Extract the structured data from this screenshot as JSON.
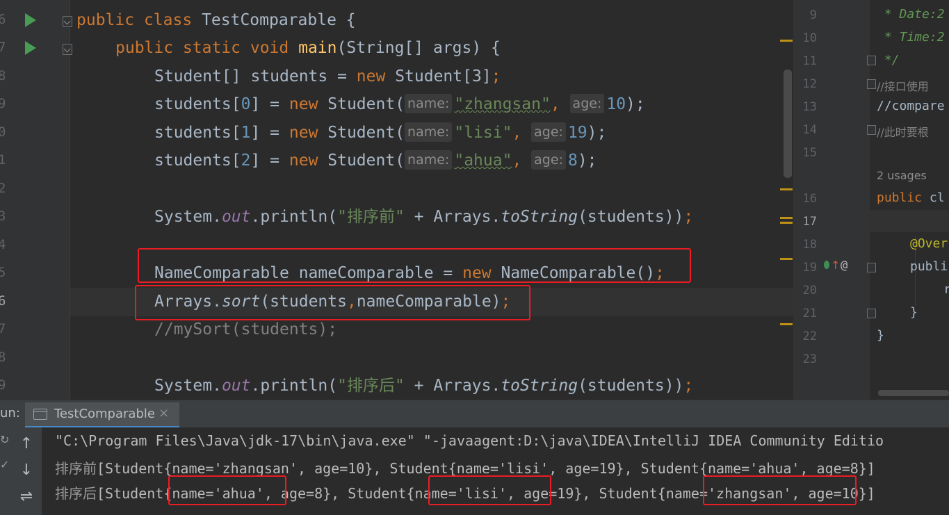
{
  "left_editor": {
    "gutter_numbers": [
      "6",
      "7",
      "8",
      "9",
      "0",
      "1",
      "2",
      "3",
      "4",
      "5",
      "6",
      "7",
      "8",
      "9"
    ],
    "line1": {
      "kw_public": "public",
      "kw_class": "class",
      "class_name": "TestComparable",
      "brace": " {"
    },
    "line2": {
      "kw": "public static void",
      "fn": "main",
      "rest": "(String[] args) {"
    },
    "line3": {
      "a": "Student[] students = ",
      "kw": "new",
      "b": " Student[3]",
      "semi": ";"
    },
    "line4": {
      "a": "students[",
      "idx": "0",
      "b": "] = ",
      "kw": "new",
      "c": " Student(",
      "hint1": "name:",
      "str": "\"zhangsan\"",
      "comma": ",",
      "hint2": "age:",
      "num": "10",
      "end": ");"
    },
    "line5": {
      "a": "students[",
      "idx": "1",
      "b": "] = ",
      "kw": "new",
      "c": " Student(",
      "hint1": "name:",
      "str": "\"lisi\"",
      "comma": ",",
      "hint2": "age:",
      "num": "19",
      "end": ");"
    },
    "line6": {
      "a": "students[",
      "idx": "2",
      "b": "] = ",
      "kw": "new",
      "c": " Student(",
      "hint1": "name:",
      "str": "\"ahua\"",
      "comma": ",",
      "hint2": "age:",
      "num": "8",
      "end": ");"
    },
    "line8": {
      "a": "System.",
      "fld": "out",
      "b": ".println(",
      "str": "\"排序前\"",
      "c": " + Arrays.",
      "it": "toString",
      "d": "(students))",
      "semi": ";"
    },
    "line10": {
      "a": "NameComparable nameComparable = ",
      "kw": "new",
      "b": " NameComparable()",
      "semi": ";"
    },
    "line11": {
      "a": "Arrays.",
      "it": "sort",
      "b": "(students",
      "comma": ",",
      "c": "nameComparable)",
      "semi": ";"
    },
    "line12": {
      "cmt": "//mySort(students);"
    },
    "line14": {
      "a": "System.",
      "fld": "out",
      "b": ".println(",
      "str": "\"排序后\"",
      "c": " + Arrays.",
      "it": "toString",
      "d": "(students))",
      "semi": ";"
    }
  },
  "right_editor": {
    "line_numbers": [
      "9",
      "10",
      "11",
      "12",
      "13",
      "14",
      "15",
      "16",
      "17",
      "18",
      "19",
      "20",
      "21",
      "22",
      "23"
    ],
    "cmt_date": " * Date:2",
    "cmt_time": " * Time:2",
    "cmt_end": " */",
    "cmt_cn1": "//接口使用",
    "cmt_compare": "//compare",
    "cmt_cn2": "//此时要根",
    "usages": "2 usages",
    "decl_kw": "public",
    "decl_rest": " cl",
    "anno": "@Over",
    "publi": "publi",
    "r": "r",
    "close_inner": "}",
    "close_outer": "}",
    "override_icon": "@"
  },
  "run_panel": {
    "label": "un:",
    "tab_title": "TestComparable",
    "close_glyph": "×",
    "up_arrow": "↑",
    "down_arrow": "↓",
    "wrap_glyph": "⇌",
    "console": {
      "cmd": "\"C:\\Program Files\\Java\\jdk-17\\bin\\java.exe\" \"-javaagent:D:\\java\\IDEA\\IntelliJ IDEA Community Editio",
      "before_prefix": "排序前",
      "before_rest": "[Student{name='zhangsan', age=10}, Student{name='lisi', age=19}, Student{name='ahua', age=8}]",
      "after_prefix": "排序后",
      "after_rest": "[Student{name='ahua', age=8}, Student{name='lisi', age=19}, Student{name='zhangsan', age=10}]"
    }
  },
  "colors": {
    "keyword": "#cc7832",
    "function": "#ffc66d",
    "string": "#6a8759",
    "number": "#6897bb",
    "field": "#9876aa",
    "highlight_box": "#ec1c24"
  }
}
